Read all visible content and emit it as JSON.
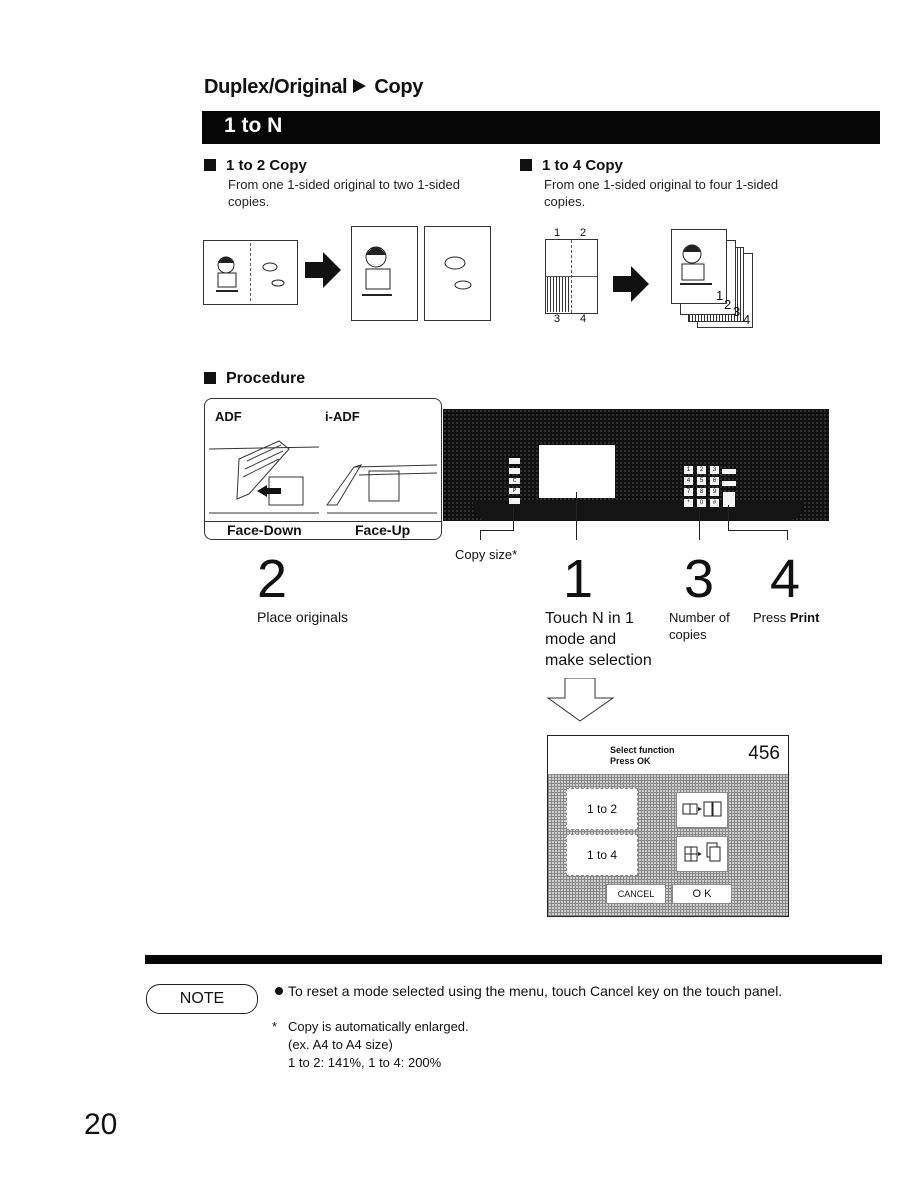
{
  "header": {
    "section": "Duplex/Original",
    "arrow_icon": "right-triangle",
    "subsection": "Copy",
    "banner_title": "1 to N"
  },
  "modes": [
    {
      "title": "1 to 2 Copy",
      "description_lines": [
        "From one 1-sided original to two 1-sided",
        "copies."
      ]
    },
    {
      "title": "1 to 4 Copy",
      "description_lines": [
        "From one 1-sided original to four 1-sided",
        "copies."
      ],
      "quadrant_labels": [
        "1",
        "2",
        "3",
        "4"
      ],
      "stack_labels": [
        "1",
        "2",
        "3",
        "4"
      ]
    }
  ],
  "procedure": {
    "title": "Procedure",
    "feeder": {
      "adf_label": "ADF",
      "iadf_label": "i-ADF",
      "face_down_label": "Face-Down",
      "face_up_label": "Face-Up"
    },
    "control_panel": {
      "left_buttons": [
        "",
        "",
        "C",
        "P",
        ""
      ],
      "keypad": [
        "1",
        "2",
        "3",
        "4",
        "5",
        "6",
        "7",
        "8",
        "9",
        "*",
        "0",
        "#"
      ],
      "side_keys": [
        "",
        "",
        ""
      ],
      "copy_size_label": "Copy size*"
    },
    "steps": [
      {
        "number": "2",
        "text": "Place originals"
      },
      {
        "number": "1",
        "text_lines": [
          "Touch N in 1",
          "mode and",
          "make selection"
        ]
      },
      {
        "number": "3",
        "text_lines": [
          "Number of",
          "copies"
        ]
      },
      {
        "number": "4",
        "text_prefix": "Press ",
        "text_bold": "Print"
      }
    ],
    "touch_panel": {
      "line1": "Select function",
      "line2": "Press OK",
      "counter": "456",
      "options": [
        {
          "label": "1 to 2",
          "icon": "one-to-two-icon"
        },
        {
          "label": "1 to 4",
          "icon": "one-to-four-icon"
        }
      ],
      "cancel_label": "CANCEL",
      "ok_label": "O K"
    }
  },
  "note": {
    "label": "NOTE",
    "bullet": "To reset a mode selected using the menu, touch Cancel key on the touch panel.",
    "footnote_marker": "*",
    "footnote_lines": [
      "Copy is automatically enlarged.",
      "(ex. A4 to A4 size)",
      "1 to 2: 141%, 1 to 4: 200%"
    ]
  },
  "page_number": "20"
}
